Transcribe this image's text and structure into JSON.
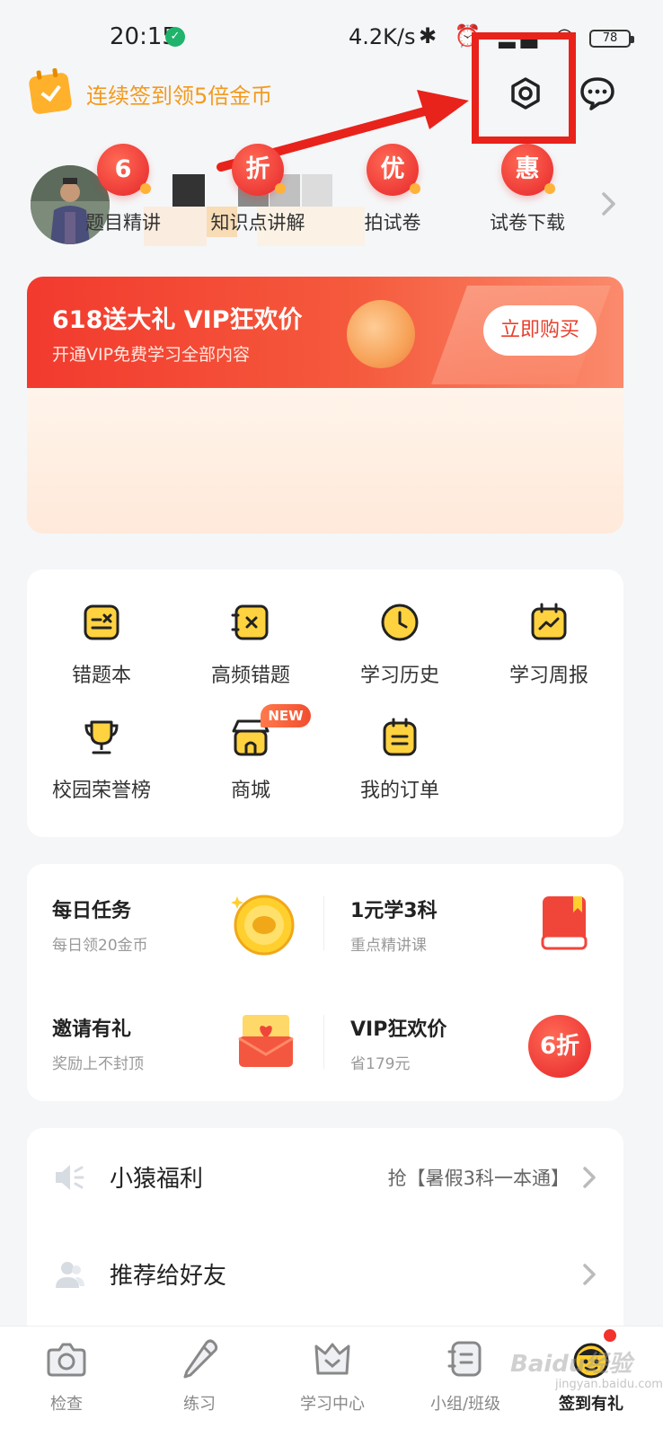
{
  "status_bar": {
    "time": "20:15",
    "network_speed": "4.2K/s",
    "icons": "✱ ⏰ ▂▄ ◠",
    "battery": "78"
  },
  "header": {
    "signin_text": "连续签到领5倍金币",
    "settings_icon": "gear-hexagon-icon",
    "message_icon": "chat-bubble-icon"
  },
  "vip_banner": {
    "title": "618送大礼 VIP狂欢价",
    "subtitle": "开通VIP免费学习全部内容",
    "buy_label": "立即购买",
    "features": [
      {
        "badge": "6",
        "label": "题目精讲"
      },
      {
        "badge": "折",
        "label": "知识点讲解"
      },
      {
        "badge": "优",
        "label": "拍试卷"
      },
      {
        "badge": "惠",
        "label": "试卷下载"
      }
    ]
  },
  "tools": {
    "items": [
      {
        "label": "错题本",
        "icon": "wrong-book-icon"
      },
      {
        "label": "高频错题",
        "icon": "frequent-errors-icon"
      },
      {
        "label": "学习历史",
        "icon": "clock-icon"
      },
      {
        "label": "学习周报",
        "icon": "weekly-report-icon"
      },
      {
        "label": "校园荣誉榜",
        "icon": "trophy-icon"
      },
      {
        "label": "商城",
        "icon": "shop-icon"
      },
      {
        "label": "我的订单",
        "icon": "order-icon"
      }
    ],
    "new_badge": "NEW"
  },
  "tasks": [
    {
      "title": "每日任务",
      "sub": "每日领20金币"
    },
    {
      "title": "1元学3科",
      "sub": "重点精讲课"
    },
    {
      "title": "邀请有礼",
      "sub": "奖励上不封顶"
    },
    {
      "title": "VIP狂欢价",
      "sub": "省179元",
      "badge": "6折"
    }
  ],
  "list": [
    {
      "label": "小猿福利",
      "right": "抢【暑假3科一本通】"
    },
    {
      "label": "推荐给好友",
      "right": ""
    }
  ],
  "bottom_nav": [
    {
      "label": "检查"
    },
    {
      "label": "练习"
    },
    {
      "label": "学习中心"
    },
    {
      "label": "小组/班级"
    },
    {
      "label": "签到有礼"
    }
  ],
  "watermark": {
    "main": "Baidu经验",
    "sub": "jingyan.baidu.com"
  },
  "colors": {
    "accent": "#f39a1e",
    "vip_red": "#f23a2e",
    "annotation": "#e8231b"
  }
}
